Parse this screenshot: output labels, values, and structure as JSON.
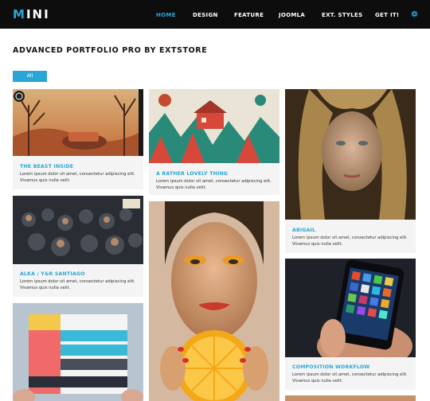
{
  "header": {
    "logo_first": "M",
    "logo_rest": "INI",
    "nav": [
      "HOME",
      "DESIGN",
      "FEATURE",
      "JOOMLA",
      "EXT. STYLES",
      "GET IT!"
    ],
    "active": "HOME",
    "settings_icon": "gear-icon",
    "accent_color": "#2aa6d6"
  },
  "page": {
    "title": "ADVANCED PORTFOLIO PRO BY EXTSTORE",
    "filter_label": "All"
  },
  "cards": [
    {
      "title": "THE BEAST INSIDE",
      "desc": "Lorem ipsum dolor sit amet, consectetur adipiscing elit. Vivamus quis nulla velit."
    },
    {
      "title": "A RATHER LOVELY THING",
      "desc": "Lorem ipsum dolor sit amet, consectetur adipiscing elit. Vivamus quis nulla velit."
    },
    {
      "title": "ABIGAIL",
      "desc": "Lorem ipsum dolor sit amet, consectetur adipiscing elit. Vivamus quis nulla velit."
    },
    {
      "title": "ALKA / Y&R SANTIAGO",
      "desc": "Lorem ipsum dolor sit amet, consectetur adipiscing elit. Vivamus quis nulla velit."
    },
    {
      "title": "COMPOSITION WORKFLOW",
      "desc": "Lorem ipsum dolor sit amet, consectetur adipiscing elit. Vivamus quis nulla velit."
    }
  ]
}
